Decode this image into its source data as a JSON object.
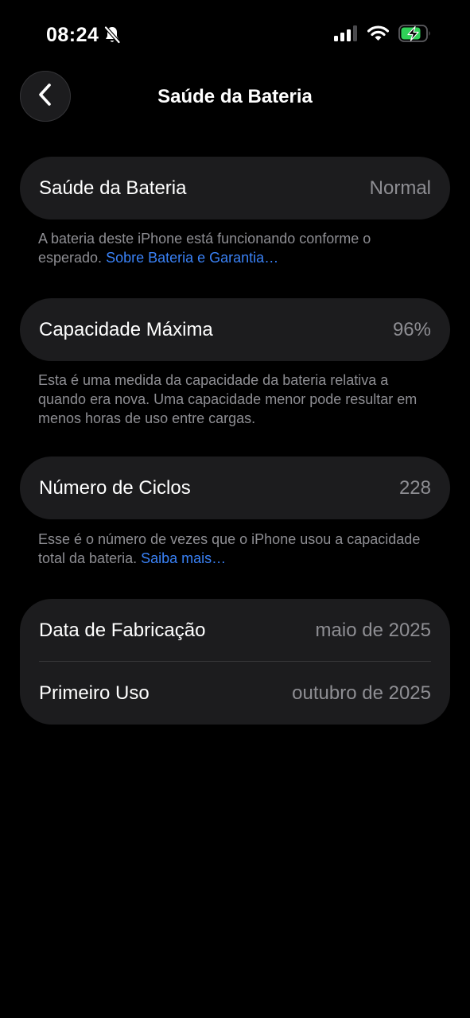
{
  "status_bar": {
    "time": "08:24",
    "icons": [
      "bell-slash-icon",
      "signal-icon",
      "wifi-icon",
      "battery-charging-icon"
    ],
    "battery_color": "#30d158"
  },
  "nav": {
    "back_icon": "chevron-left-icon",
    "title": "Saúde da Bateria"
  },
  "battery_health": {
    "label": "Saúde da Bateria",
    "value": "Normal",
    "footnote": "A bateria deste iPhone está funcionando conforme o esperado.",
    "link": "Sobre Bateria e Garantia…"
  },
  "max_capacity": {
    "label": "Capacidade Máxima",
    "value": "96%",
    "footnote": "Esta é uma medida da capacidade da bateria relativa a quando era nova. Uma capacidade menor pode resultar em menos horas de uso entre cargas."
  },
  "cycle_count": {
    "label": "Número de Ciclos",
    "value": "228",
    "footnote": "Esse é o número de vezes que o iPhone usou a capacidade total da bateria.",
    "link": "Saiba mais…"
  },
  "dates": {
    "manufacture_label": "Data de Fabricação",
    "manufacture_value": "maio de 2025",
    "first_use_label": "Primeiro Uso",
    "first_use_value": "outubro de 2025"
  },
  "colors": {
    "background": "#000000",
    "card": "#1c1c1e",
    "secondary_text": "#8e8e93",
    "link": "#3a82f7"
  }
}
